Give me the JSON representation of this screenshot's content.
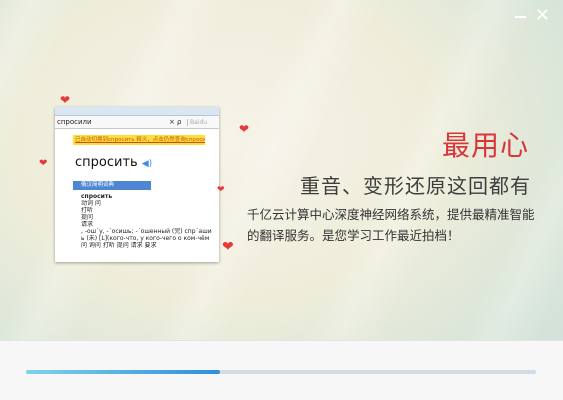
{
  "window": {
    "minimize_icon": "minimize-icon",
    "close_icon": "close-icon",
    "close_glyph": "✕"
  },
  "screenshot": {
    "search_query": "спросили",
    "search_clear": "×",
    "search_icon": "ρ",
    "search_placeholder": "Baidu",
    "banner": "已自动切换到спросить 释义，点击仍然查询спросили",
    "headword_display": "спросить",
    "speaker": "◀)",
    "dict_tab": "俄汉简明词典",
    "entries": [
      "спросить",
      "动词 问",
      "打听",
      "提问",
      "请求",
      ", -ошˊу, -ˊосишь; -ˊошенный (完) спрˊаши",
      "ь (未) [L](кого-что, у кого-чего о ком-чём",
      "问   询问   打听   提问   请求   要求"
    ]
  },
  "headline": {
    "title": "最用心",
    "subtitle": "重音、变形还原这回都有",
    "description": "千亿云计算中心深度神经网络系统，提供最精准智能的翻译服务。是您学习工作最近拍档！"
  },
  "progress": {
    "value": 0.38,
    "color_start": "#7ed3ec",
    "color_end": "#2d8fd8"
  },
  "colors": {
    "accent_red": "#d9363a",
    "heart": "#e63a3a"
  }
}
